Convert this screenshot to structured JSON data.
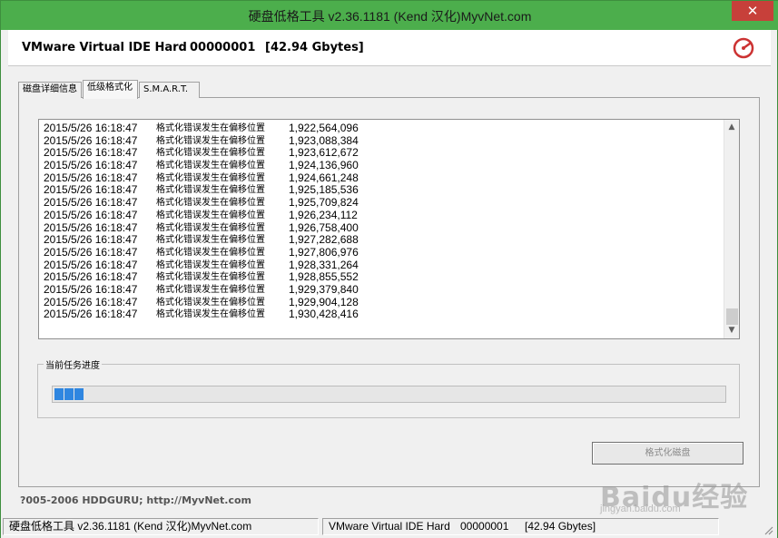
{
  "window": {
    "title": "硬盘低格工具 v2.36.1181 (Kend 汉化)MyvNet.com",
    "close_glyph": "✕"
  },
  "header": {
    "model": "VMware Virtual IDE Hard",
    "serial": "00000001",
    "size": "[42.94 Gbytes]",
    "app_icon": "app-logo-icon"
  },
  "tabs": [
    {
      "label": "磁盘详细信息",
      "active": false
    },
    {
      "label": "低级格式化",
      "active": true
    },
    {
      "label": "S.M.A.R.T.",
      "active": false
    }
  ],
  "log": {
    "rows": [
      {
        "time": "2015/5/26 16:18:47",
        "message": "格式化错误发生在偏移位置",
        "offset": "1,922,564,096"
      },
      {
        "time": "2015/5/26 16:18:47",
        "message": "格式化错误发生在偏移位置",
        "offset": "1,923,088,384"
      },
      {
        "time": "2015/5/26 16:18:47",
        "message": "格式化错误发生在偏移位置",
        "offset": "1,923,612,672"
      },
      {
        "time": "2015/5/26 16:18:47",
        "message": "格式化错误发生在偏移位置",
        "offset": "1,924,136,960"
      },
      {
        "time": "2015/5/26 16:18:47",
        "message": "格式化错误发生在偏移位置",
        "offset": "1,924,661,248"
      },
      {
        "time": "2015/5/26 16:18:47",
        "message": "格式化错误发生在偏移位置",
        "offset": "1,925,185,536"
      },
      {
        "time": "2015/5/26 16:18:47",
        "message": "格式化错误发生在偏移位置",
        "offset": "1,925,709,824"
      },
      {
        "time": "2015/5/26 16:18:47",
        "message": "格式化错误发生在偏移位置",
        "offset": "1,926,234,112"
      },
      {
        "time": "2015/5/26 16:18:47",
        "message": "格式化错误发生在偏移位置",
        "offset": "1,926,758,400"
      },
      {
        "time": "2015/5/26 16:18:47",
        "message": "格式化错误发生在偏移位置",
        "offset": "1,927,282,688"
      },
      {
        "time": "2015/5/26 16:18:47",
        "message": "格式化错误发生在偏移位置",
        "offset": "1,927,806,976"
      },
      {
        "time": "2015/5/26 16:18:47",
        "message": "格式化错误发生在偏移位置",
        "offset": "1,928,331,264"
      },
      {
        "time": "2015/5/26 16:18:47",
        "message": "格式化错误发生在偏移位置",
        "offset": "1,928,855,552"
      },
      {
        "time": "2015/5/26 16:18:47",
        "message": "格式化错误发生在偏移位置",
        "offset": "1,929,379,840"
      },
      {
        "time": "2015/5/26 16:18:47",
        "message": "格式化错误发生在偏移位置",
        "offset": "1,929,904,128"
      },
      {
        "time": "2015/5/26 16:18:47",
        "message": "格式化错误发生在偏移位置",
        "offset": "1,930,428,416"
      }
    ]
  },
  "progress": {
    "label": "当前任务进度",
    "segments": 3,
    "color": "#2f86e0"
  },
  "format_button": {
    "label": "格式化磁盘",
    "enabled": false
  },
  "footer": {
    "text": "?005-2006 HDDGURU;   http://MyvNet.com"
  },
  "statusbar": {
    "left": "硬盘低格工具 v2.36.1181 (Kend 汉化)MyvNet.com",
    "model": "VMware Virtual IDE Hard",
    "serial": "00000001",
    "size": "[42.94 Gbytes]"
  },
  "watermark": {
    "text": "Baidu经验",
    "sub": "jingyan.baidu.com"
  },
  "colors": {
    "titlebar": "#4cae4c",
    "close": "#c7403a",
    "progress": "#2f86e0"
  }
}
